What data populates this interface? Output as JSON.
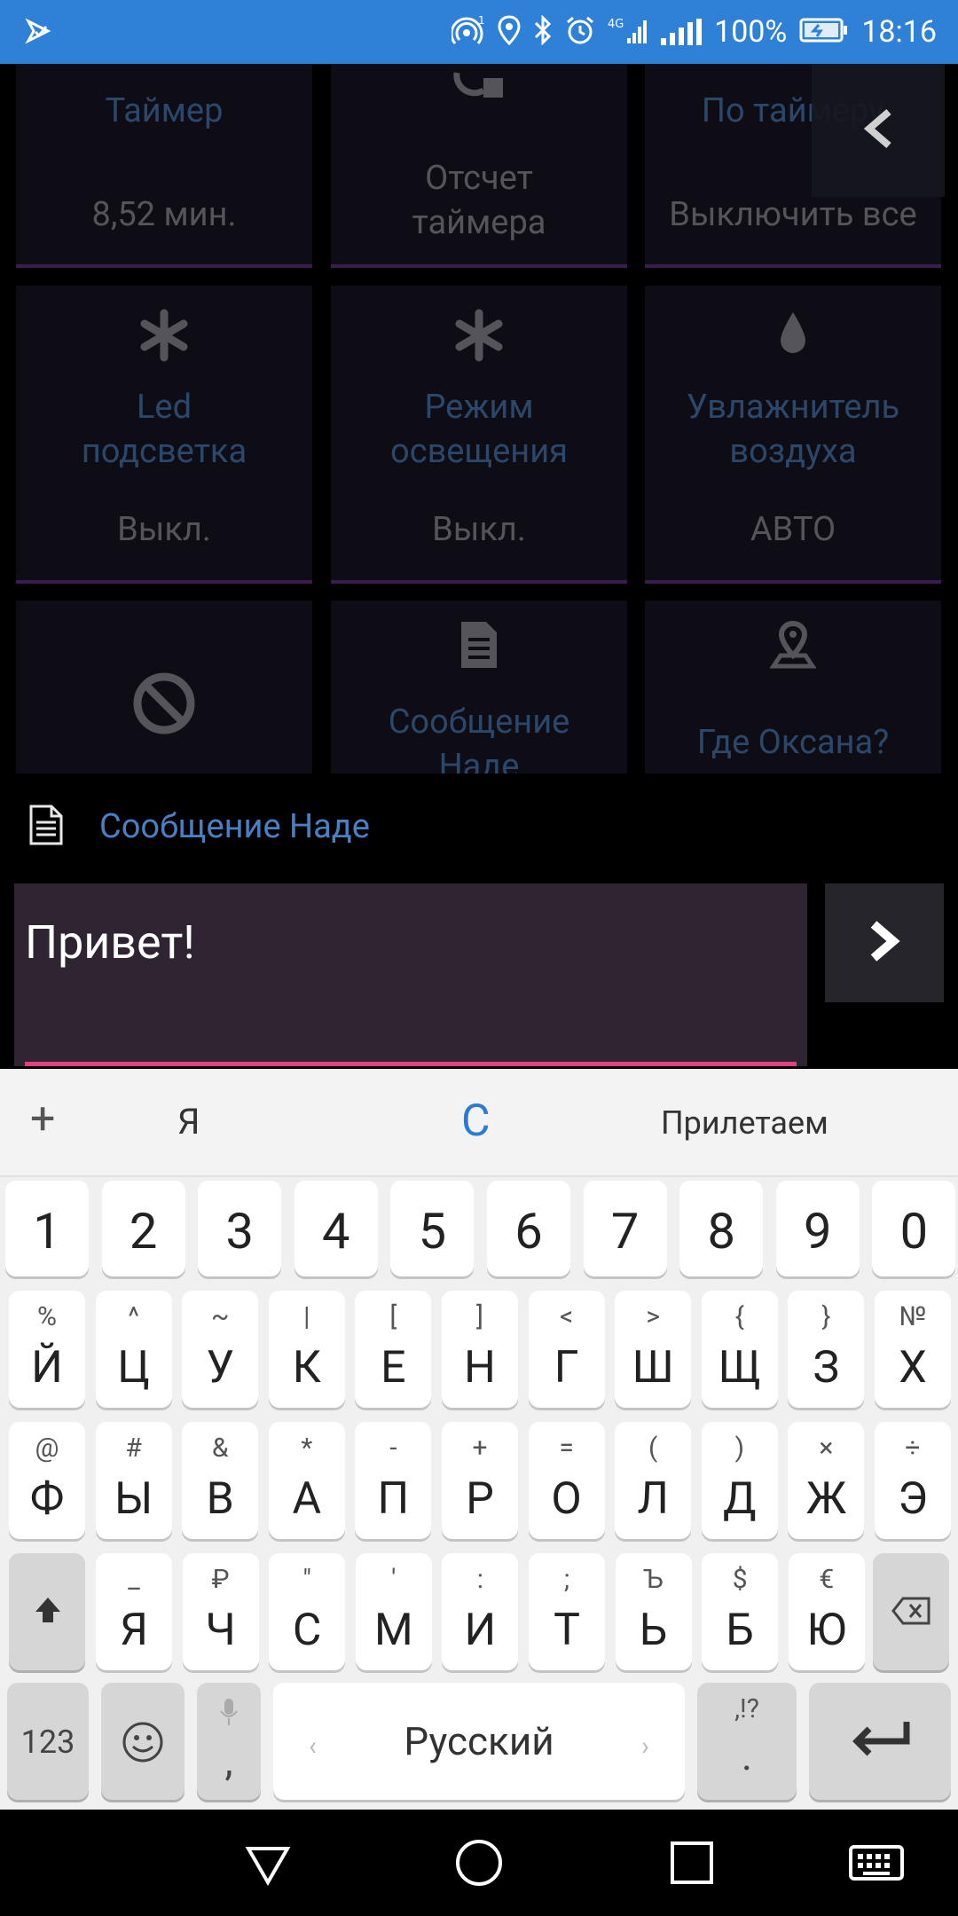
{
  "status_bar": {
    "battery": "100%",
    "time": "18:16",
    "network": "4G"
  },
  "tiles": [
    {
      "title": "Таймер",
      "value": "8,52 мин."
    },
    {
      "label": "Отсчет таймера",
      "icon": "timer-icon"
    },
    {
      "title": "По таймеру",
      "value": "Выключить все"
    },
    {
      "title": "Led подсветка",
      "value": "Выкл.",
      "icon": "asterisk-icon"
    },
    {
      "title": "Режим освещения",
      "value": "Выкл.",
      "icon": "asterisk-icon"
    },
    {
      "title": "Увлажнитель воздуха",
      "value": "АВТО",
      "icon": "drop-icon"
    },
    {
      "icon": "block-icon"
    },
    {
      "title": "Сообщение Наде",
      "icon": "document-icon"
    },
    {
      "title": "Где Оксана?",
      "icon": "location-icon"
    }
  ],
  "message": {
    "title": "Сообщение Наде",
    "value": "Привет!"
  },
  "keyboard": {
    "suggestions": [
      "Я",
      "С",
      "Прилетаем"
    ],
    "row_numbers": [
      "1",
      "2",
      "3",
      "4",
      "5",
      "6",
      "7",
      "8",
      "9",
      "0"
    ],
    "row1": [
      {
        "sup": "%",
        "main": "Й"
      },
      {
        "sup": "^",
        "main": "Ц"
      },
      {
        "sup": "~",
        "main": "У"
      },
      {
        "sup": "|",
        "main": "К"
      },
      {
        "sup": "[",
        "main": "Е"
      },
      {
        "sup": "]",
        "main": "Н"
      },
      {
        "sup": "<",
        "main": "Г"
      },
      {
        "sup": ">",
        "main": "Ш"
      },
      {
        "sup": "{",
        "main": "Щ"
      },
      {
        "sup": "}",
        "main": "З"
      },
      {
        "sup": "№",
        "main": "Х"
      }
    ],
    "row2": [
      {
        "sup": "@",
        "main": "Ф"
      },
      {
        "sup": "#",
        "main": "Ы"
      },
      {
        "sup": "&",
        "main": "В"
      },
      {
        "sup": "*",
        "main": "А"
      },
      {
        "sup": "-",
        "main": "П"
      },
      {
        "sup": "+",
        "main": "Р"
      },
      {
        "sup": "=",
        "main": "О"
      },
      {
        "sup": "(",
        "main": "Л"
      },
      {
        "sup": ")",
        "main": "Д"
      },
      {
        "sup": "×",
        "main": "Ж"
      },
      {
        "sup": "÷",
        "main": "Э"
      }
    ],
    "row3": [
      {
        "sup": "_",
        "main": "Я"
      },
      {
        "sup": "₽",
        "main": "Ч"
      },
      {
        "sup": "\"",
        "main": "С"
      },
      {
        "sup": "'",
        "main": "М"
      },
      {
        "sup": ":",
        "main": "И"
      },
      {
        "sup": ";",
        "main": "Т"
      },
      {
        "sup": "Ъ",
        "main": "Ь"
      },
      {
        "sup": "$",
        "main": "Б"
      },
      {
        "sup": "€",
        "main": "Ю"
      }
    ],
    "bottom": {
      "symbols": "123",
      "comma": ",",
      "space": "Русский",
      "punct_sup": ",!?",
      "period": "."
    }
  },
  "colors": {
    "status_bar": "#2f80d7",
    "accent_pink": "#e63f7f",
    "link_blue": "#4a7fc1"
  }
}
